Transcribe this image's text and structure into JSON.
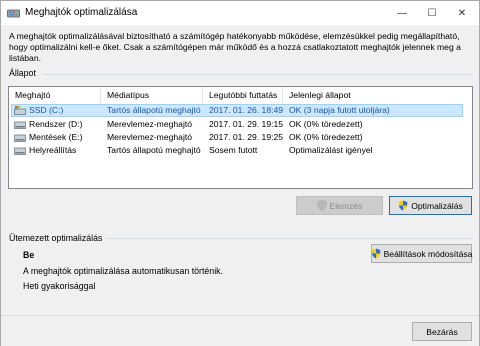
{
  "window": {
    "title": "Meghajtók optimalizálása",
    "controls": {
      "minimize": "—",
      "maximize": "☐",
      "close": "✕"
    }
  },
  "description": {
    "line1": "A meghajtók optimalizálásával biztosítható a számítógép hatékonyabb működése, elemzésükkel pedig megállapítható,",
    "line2": "hogy optimalizálni kell-e őket. Csak a számítógépen már működő és a hozzá csatlakoztatott meghajtók jelennek meg a",
    "line3": "listában."
  },
  "status_section": {
    "label": "Állapot"
  },
  "table": {
    "columns": [
      "Meghajtó",
      "Médiatípus",
      "Legutóbbi futtatás",
      "Jelenlegi állapot"
    ],
    "rows": [
      {
        "drive": "SSD (C:)",
        "media": "Tartós állapotú meghajtó",
        "last_run": "2017. 01. 26. 18:49",
        "status": "OK (3 napja futott utoljára)",
        "selected": true,
        "icon": "windows-drive-icon"
      },
      {
        "drive": "Rendszer (D:)",
        "media": "Merevlemez-meghajtó",
        "last_run": "2017. 01. 29. 19:15",
        "status": "OK (0% töredezett)",
        "selected": false,
        "icon": "hard-drive-icon"
      },
      {
        "drive": "Mentések (E:)",
        "media": "Merevlemez-meghajtó",
        "last_run": "2017. 01. 29. 19:25",
        "status": "OK (0% töredezett)",
        "selected": false,
        "icon": "hard-drive-icon"
      },
      {
        "drive": "Helyreállítás",
        "media": "Tartós állapotú meghajtó",
        "last_run": "Sosem futott",
        "status": "Optimalizálást igényel",
        "selected": false,
        "icon": "hard-drive-icon"
      }
    ]
  },
  "buttons": {
    "analyze": "Elemzés",
    "optimize": "Optimalizálás",
    "change_settings": "Beállítások módosítása",
    "close": "Bezárás"
  },
  "scheduled": {
    "label": "Ütemezett optimalizálás",
    "state": "Be",
    "info": "A meghajtók optimalizálása automatikusan történik.",
    "frequency": "Heti gyakorisággal"
  },
  "colors": {
    "selection_bg": "#cce8ff",
    "selection_border": "#99d1ff",
    "section_label": "#000000",
    "accent": "#0078d7"
  }
}
